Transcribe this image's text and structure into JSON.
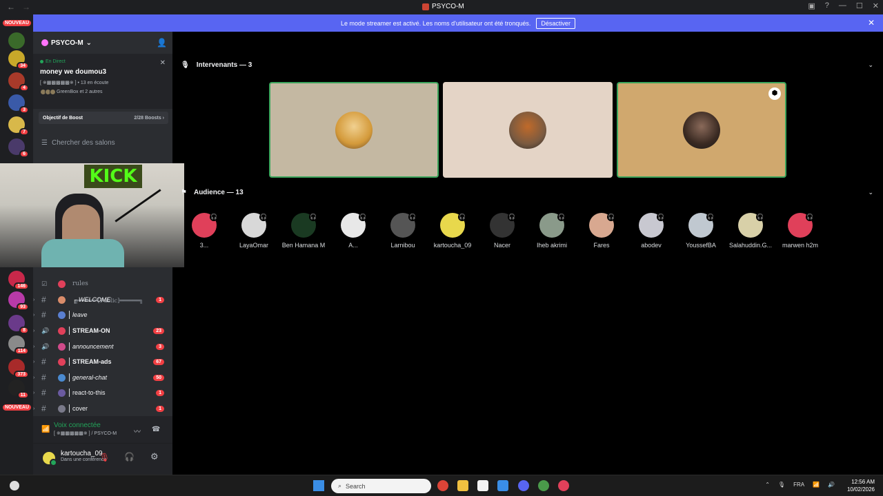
{
  "window": {
    "title": "PSYCO-M",
    "back": "←",
    "forward": "→"
  },
  "banner": {
    "text": "Le mode streamer est activé. Les noms d'utilisateur ont été tronqués.",
    "button": "Désactiver",
    "close": "✕"
  },
  "rail": {
    "badges": [
      "NOUVEAU",
      "34",
      "4",
      "3",
      "7",
      "6",
      "146",
      "93",
      "8",
      "114",
      "373",
      "11",
      "NOUVEAU"
    ]
  },
  "server": {
    "name": "PSYCO-M",
    "live": {
      "tag": "En Direct",
      "title": "money we doumou3",
      "meta": "[ ※▩▩▩▩▩※ ] • 13 en écoute",
      "listeners": "GreenBox et 2 autres"
    },
    "boost": {
      "label": "Objectif de Boost",
      "value": "2/28 Boosts ›"
    },
    "search_placeholder": "Chercher des salons",
    "category": "╔══════[Public]══════╗",
    "rules_label": "rules",
    "channels": [
      {
        "prefix": "#",
        "name": "┌ WELCOME",
        "count": "1",
        "style": "it",
        "emoji": "#d98c6a"
      },
      {
        "prefix": "#",
        "name": "leave",
        "count": "",
        "style": "it",
        "emoji": "#5a7fd0"
      },
      {
        "prefix": "🔊",
        "name": "STREAM-ON",
        "count": "23",
        "style": "bd",
        "emoji": "#e0405a"
      },
      {
        "prefix": "🔊",
        "name": "announcement",
        "count": "3",
        "style": "it",
        "emoji": "#d04a8a"
      },
      {
        "prefix": "#",
        "name": "STREAM-ads",
        "count": "67",
        "style": "bd",
        "emoji": "#e0405a"
      },
      {
        "prefix": "#",
        "name": "general-chat",
        "count": "50",
        "style": "it",
        "emoji": "#4a8ad0"
      },
      {
        "prefix": "#",
        "name": "react-to-this",
        "count": "1",
        "style": "",
        "emoji": "#6a5aa0"
      },
      {
        "prefix": "#",
        "name": "cover",
        "count": "1",
        "style": "",
        "emoji": "#7a7a8a"
      }
    ],
    "voice": {
      "state": "Voix connectée",
      "sub": "[ ※▩▩▩▩▩※ ] / PSYCO-M"
    },
    "user": {
      "name": "kartoucha_09",
      "status": "Dans une conférence"
    }
  },
  "stage": {
    "speakers_header": "Intervenants — 3",
    "audience_header": "Audience — 13",
    "speakers": [
      {
        "bg": "#c4b8a2",
        "avatar": "#d49a3a",
        "speaking": true,
        "badge": ""
      },
      {
        "bg": "#e4d4c6",
        "avatar": "#7a5a40",
        "speaking": false,
        "badge": ""
      },
      {
        "bg": "#d0a86e",
        "avatar": "#3a2a22",
        "speaking": true,
        "badge": "⬢"
      }
    ],
    "audience": [
      {
        "name": "3...",
        "color": "#e0405a"
      },
      {
        "name": "LayaOmar",
        "color": "#d8d8d8"
      },
      {
        "name": "Ben Hamana M",
        "color": "#1a3a22"
      },
      {
        "name": "A...",
        "color": "#e8e8e8"
      },
      {
        "name": "Larnibou",
        "color": "#555555"
      },
      {
        "name": "kartoucha_09",
        "color": "#e8d84c"
      },
      {
        "name": "Nacer",
        "color": "#333333"
      },
      {
        "name": "Iheb akrimi",
        "color": "#8a9a8a"
      },
      {
        "name": "Fares",
        "color": "#d8a890"
      },
      {
        "name": "abodev",
        "color": "#c8c8d0"
      },
      {
        "name": "YoussefBA",
        "color": "#c0c8d0"
      },
      {
        "name": "Salahuddin.G...",
        "color": "#d8d0a8"
      },
      {
        "name": "marwen h2m",
        "color": "#e0405a"
      }
    ]
  },
  "taskbar": {
    "search_label": "Search",
    "lang": "FRA",
    "time": "12:56 AM",
    "date": "10/02/2026"
  }
}
